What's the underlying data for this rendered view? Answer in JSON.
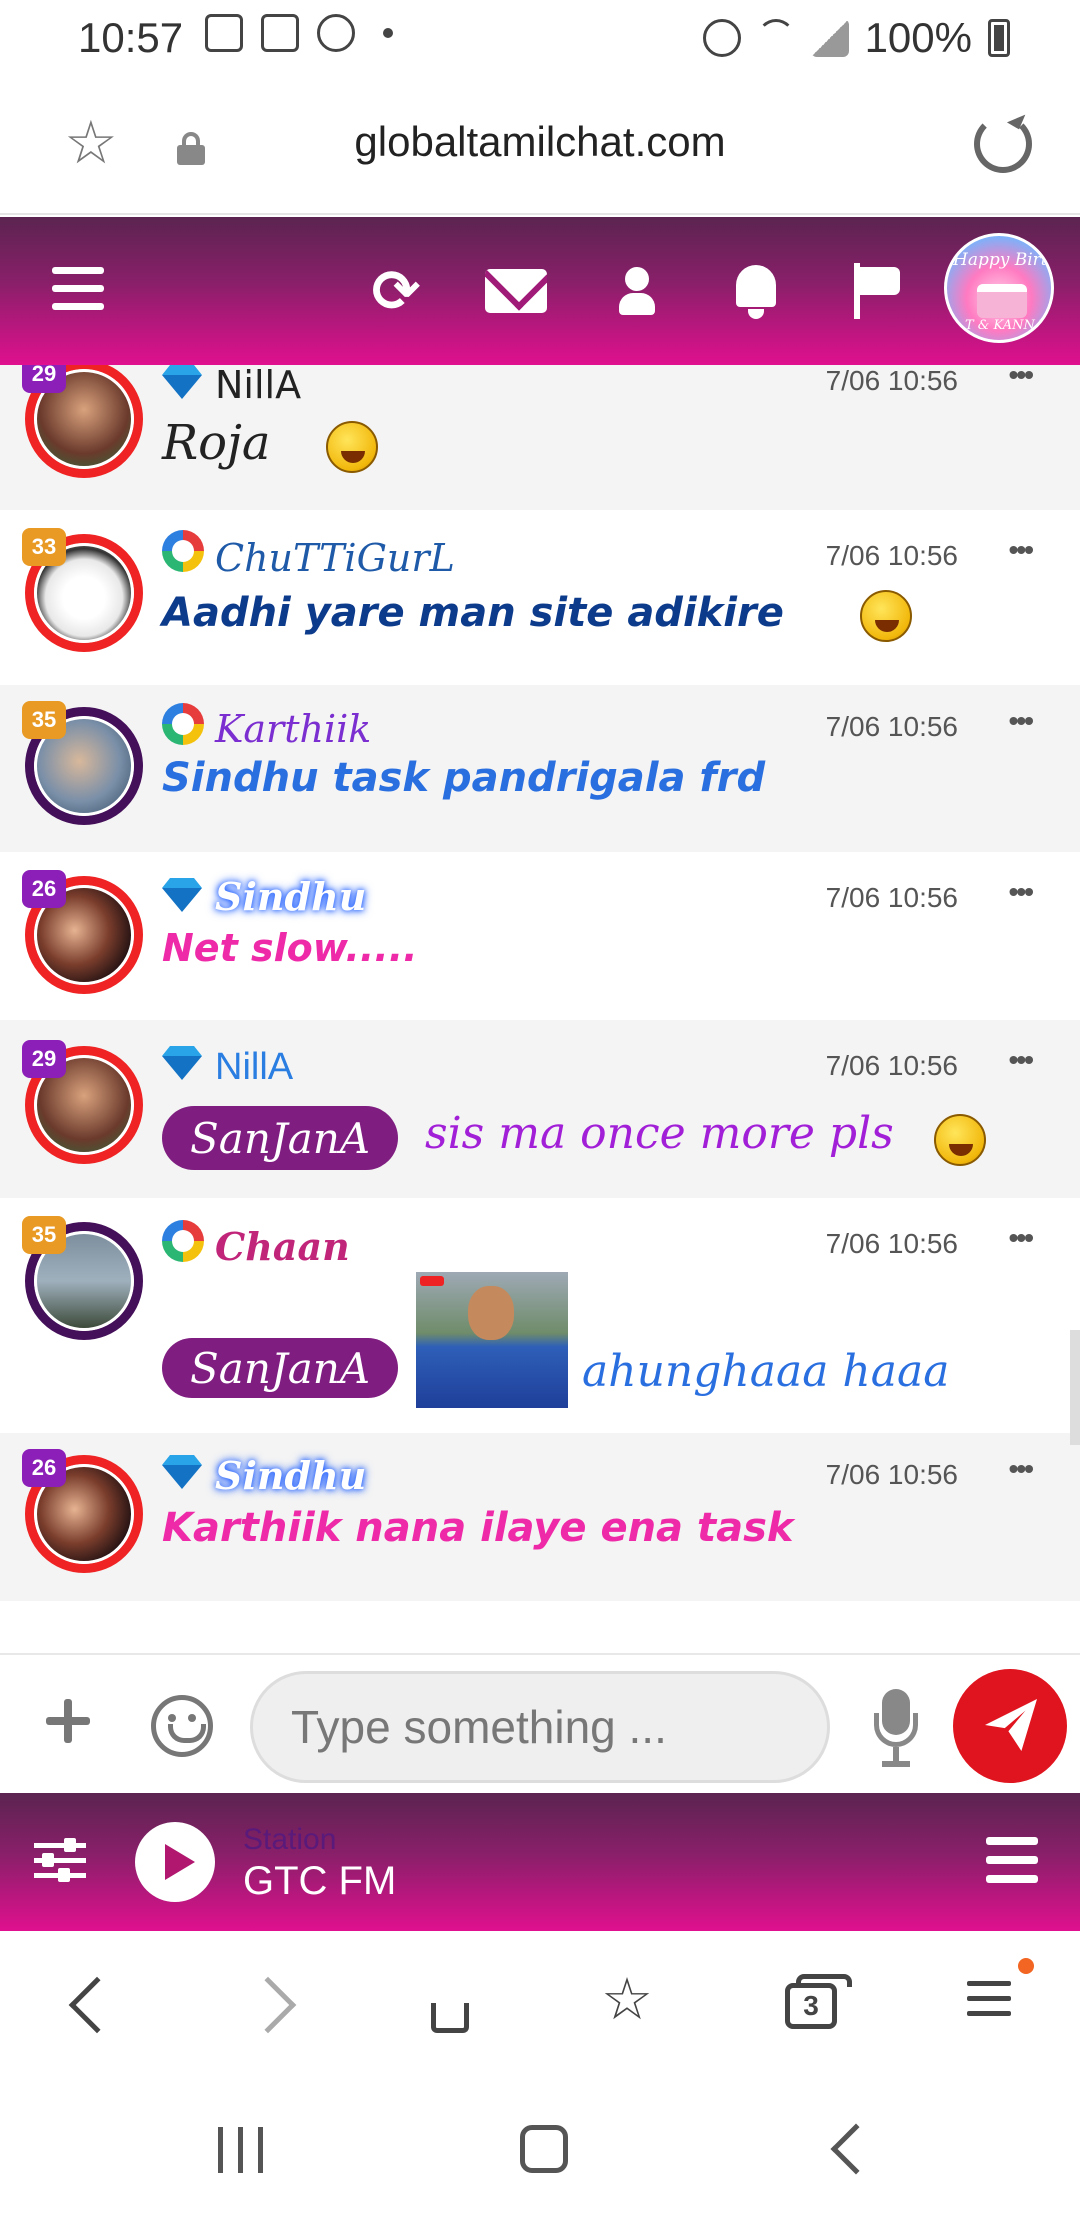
{
  "status_bar": {
    "time": "10:57",
    "battery_percent": "100%",
    "icons_left": [
      "gallery-icon",
      "cast-icon",
      "play-icon",
      "dot-icon"
    ],
    "icons_right": [
      "alarm-icon",
      "wifi-icon",
      "signal-icon",
      "battery-charging-icon"
    ]
  },
  "browser": {
    "url": "globaltamilchat.com",
    "tab_count": "3"
  },
  "app_header": {
    "icons": [
      "menu-icon",
      "refresh-icon",
      "mail-icon",
      "user-icon",
      "bell-icon",
      "flag-icon"
    ],
    "avatar_text_top": "Happy Birthd",
    "avatar_text_bottom": "T & KANNA"
  },
  "colors": {
    "brand_gradient_top": "#5b2450",
    "brand_gradient_bottom": "#e0108e",
    "send_button": "#e0141e",
    "tag_bg": "#7f1e80"
  },
  "messages": [
    {
      "rank": "29",
      "badge": "diamond",
      "username": "NillA",
      "username_color": "#2a7de1",
      "time": "7/06 10:56",
      "text": "Roja",
      "text_color": "#9b1fd6",
      "has_emoji": true
    },
    {
      "rank": "33",
      "badge": "ring",
      "username": "ChuTTiGurL",
      "username_color": "#1e5aa8",
      "time": "7/06 10:56",
      "text": "Aadhi yare man site adikire",
      "text_color": "#0d3b8c",
      "has_emoji": true
    },
    {
      "rank": "35",
      "badge": "ring",
      "username": "Karthiik",
      "username_color": "#7b2fd0",
      "time": "7/06 10:56",
      "text": "Sindhu task pandrigala frd",
      "text_color": "#2a6fe0",
      "has_emoji": false
    },
    {
      "rank": "26",
      "badge": "diamond",
      "username": "Sindhu",
      "username_color": "#ffffff",
      "time": "7/06 10:56",
      "text": "Net slow.....",
      "text_color": "#ee2aa8",
      "has_emoji": false
    },
    {
      "rank": "29",
      "badge": "diamond",
      "username": "NillA",
      "username_color": "#2a7de1",
      "time": "7/06 10:56",
      "tag": "SanJanA",
      "text": "sis ma once more pls",
      "text_color": "#a21fd8",
      "has_emoji": true
    },
    {
      "rank": "35",
      "badge": "ring",
      "username": "Chaan",
      "username_color": "#c0257a",
      "time": "7/06 10:56",
      "tag": "SanJanA",
      "text": "ahunghaaa haaa",
      "text_color": "#2a6fe0",
      "has_emoji": false,
      "has_image": true
    },
    {
      "rank": "26",
      "badge": "diamond",
      "username": "Sindhu",
      "username_color": "#ffffff",
      "time": "7/06 10:56",
      "text": "Karthiik nana ilaye ena task",
      "text_color": "#ee2aa8",
      "has_emoji": false
    }
  ],
  "input": {
    "placeholder": "Type something ..."
  },
  "radio": {
    "label": "Station",
    "name": "GTC FM"
  }
}
